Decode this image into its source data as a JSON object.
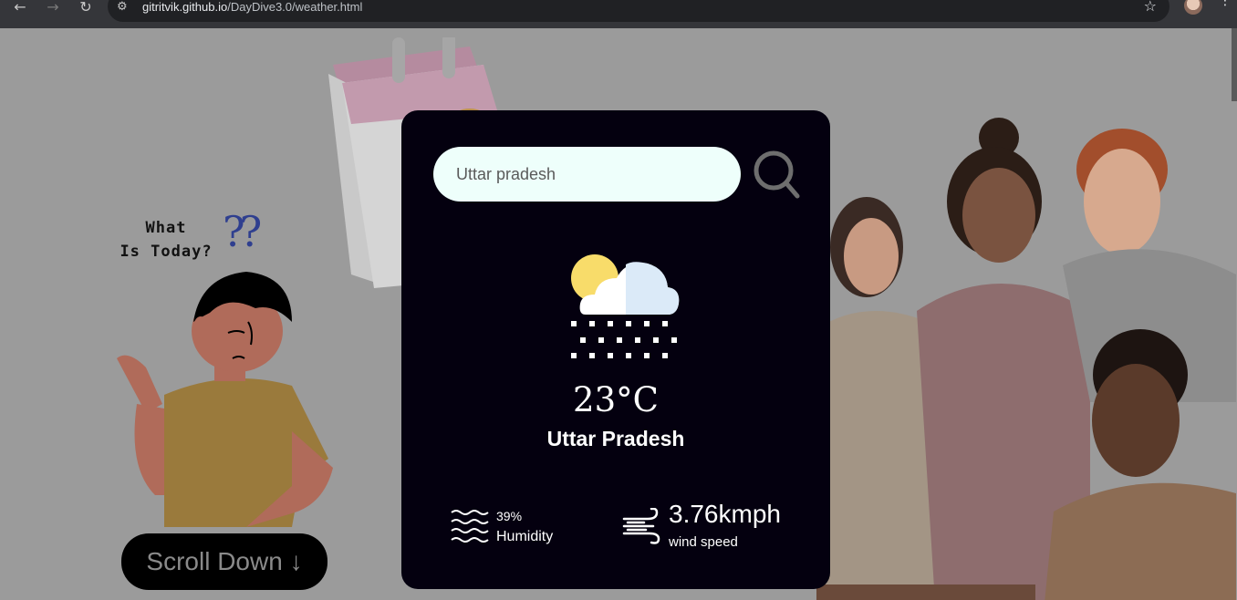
{
  "browser": {
    "url_host": "gitritvik.github.io",
    "url_path": "/DayDive3.0/weather.html"
  },
  "page": {
    "question_line1": "What",
    "question_line2": "Is Today?",
    "question_marks": "??",
    "scroll_button": "Scroll Down ↓"
  },
  "weather": {
    "search_value": "Uttar pradesh",
    "temperature": "23°C",
    "city": "Uttar Pradesh",
    "humidity_value": "39%",
    "humidity_label": "Humidity",
    "wind_value": "3.76kmph",
    "wind_label": "wind speed",
    "condition_icon": "cloud-sun-snow-icon"
  },
  "colors": {
    "card_bg": "#04000f",
    "search_bg": "#eefffb",
    "overlay": "#9b9b9b"
  }
}
